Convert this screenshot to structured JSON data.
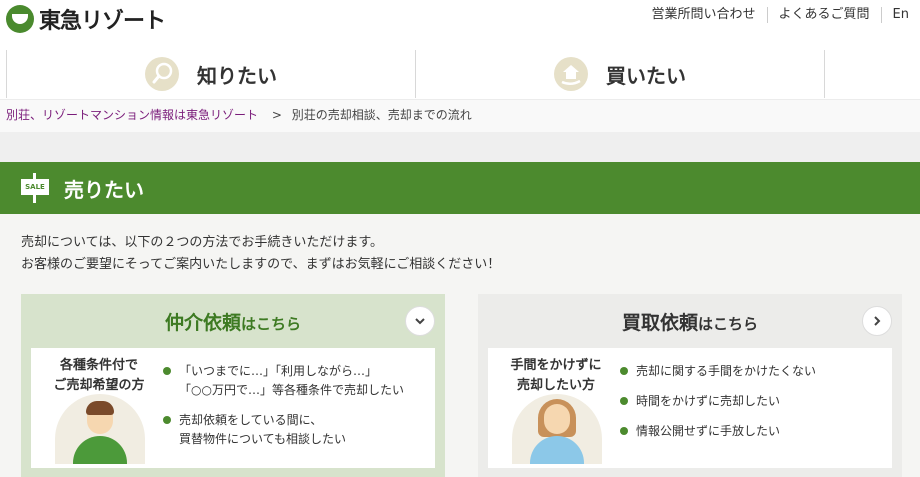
{
  "header": {
    "logo_text": "東急リゾート",
    "util_links": [
      "営業所問い合わせ",
      "よくあるご質問",
      "En"
    ]
  },
  "nav": {
    "items": [
      {
        "label": "知りたい"
      },
      {
        "label": "買いたい"
      }
    ]
  },
  "breadcrumb": {
    "link": "別荘、リゾートマンション情報は東急リゾート",
    "separator": ">",
    "current": "別荘の売却相談、売却までの流れ"
  },
  "sell": {
    "sign_text": "SALE",
    "title": "売りたい",
    "intro_line1": "売却については、以下の２つの方法でお手続きいただけます。",
    "intro_line2": "お客様のご要望にそってご案内いたしますので、まずはお気軽にご相談ください！"
  },
  "cards": [
    {
      "title": "仲介依頼",
      "title_suffix": "はこちら",
      "button_icon": "chevron-down-icon",
      "target_line1": "各種条件付で",
      "target_line2": "ご売却希望の方",
      "bullets": [
        {
          "line1": "「いつまでに…」「利用しながら…」",
          "line2": "「○○万円で…」等各種条件で売却したい"
        },
        {
          "line1": "売却依頼をしている間に、",
          "line2": "買替物件についても相談したい"
        }
      ]
    },
    {
      "title": "買取依頼",
      "title_suffix": "はこちら",
      "button_icon": "chevron-right-icon",
      "target_line1": "手間をかけずに",
      "target_line2": "売却したい方",
      "bullets": [
        {
          "line1": "売却に関する手間をかけたくない"
        },
        {
          "line1": "時間をかけずに売却したい"
        },
        {
          "line1": "情報公開せずに手放したい"
        }
      ]
    }
  ],
  "colors": {
    "brand_green": "#4c8a2e",
    "card_a_bg": "#d7e3cc",
    "card_b_bg": "#ececea",
    "breadcrumb_link": "#7a1c7a"
  }
}
